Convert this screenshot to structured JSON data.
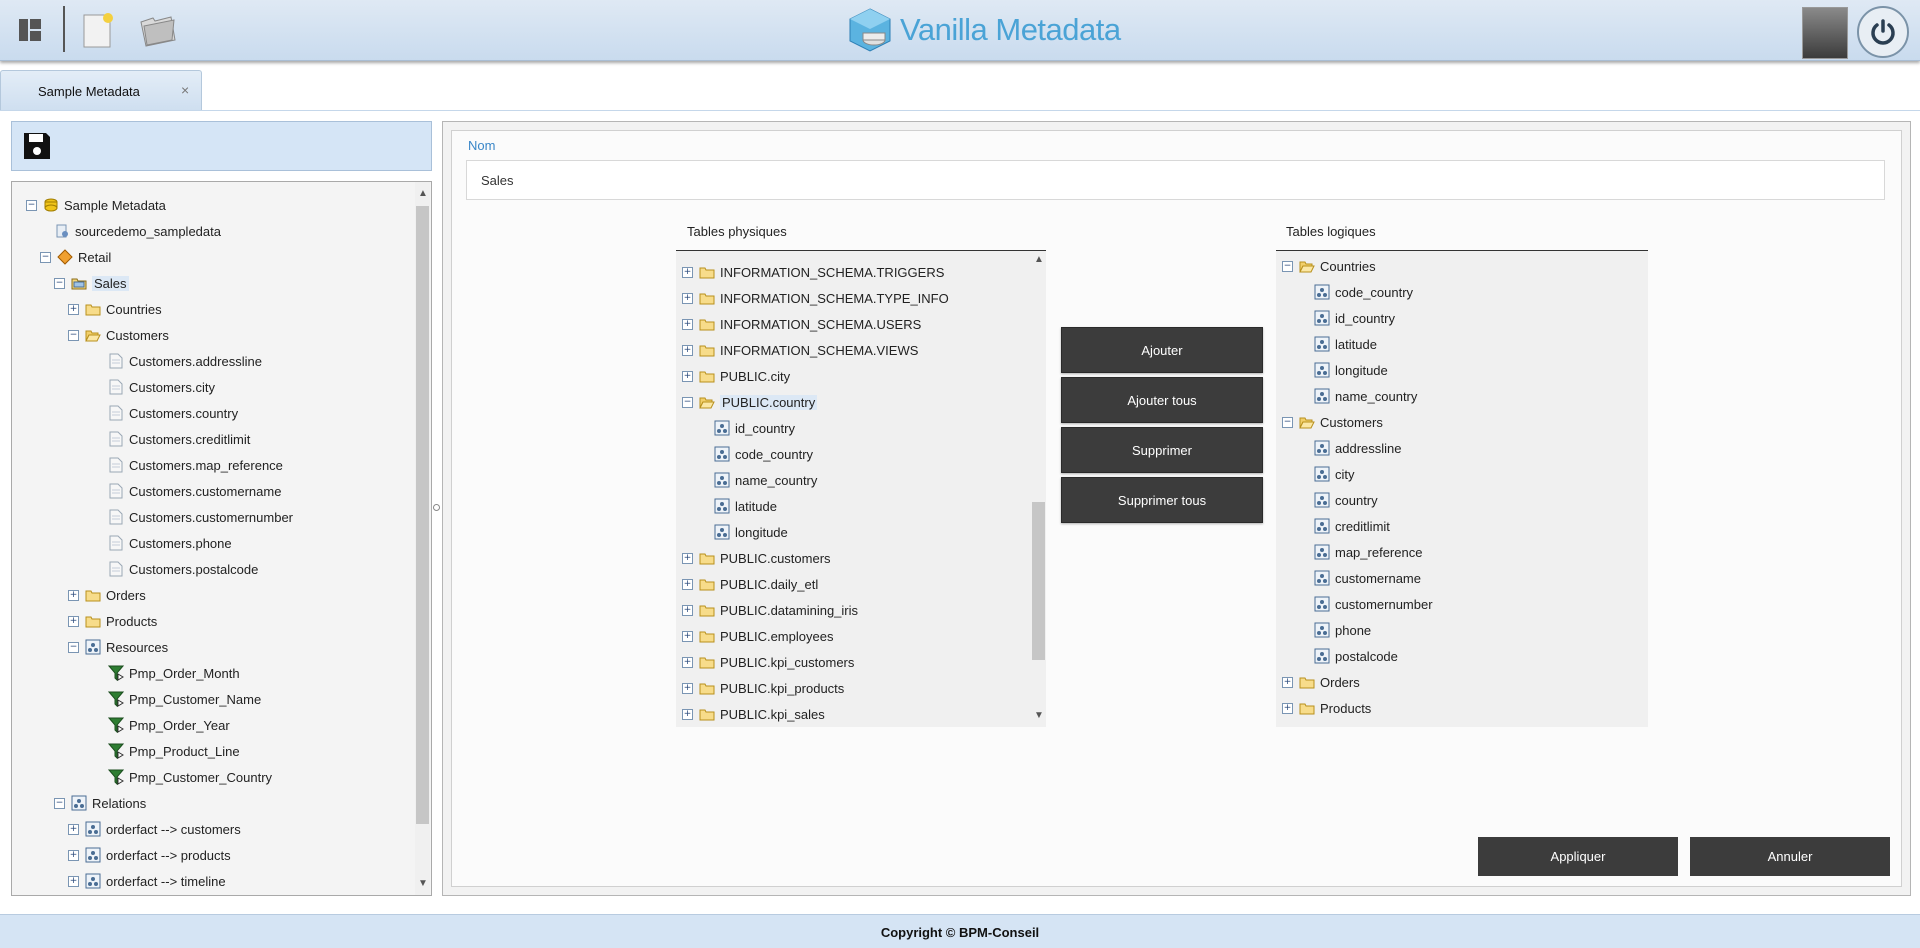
{
  "app": {
    "title": "Vanilla Metadata"
  },
  "tab": {
    "label": "Sample Metadata",
    "close": "×"
  },
  "tree": {
    "items": [
      {
        "label": "Sample Metadata",
        "expander": "⊟",
        "icon": "metadata-icon"
      },
      {
        "label": "sourcedemo_sampledata",
        "icon": "datasource-icon"
      },
      {
        "label": "Retail",
        "expander": "⊟",
        "icon": "business-model-icon"
      },
      {
        "label": "Sales",
        "expander": "⊟",
        "icon": "package-icon"
      },
      {
        "label": "Countries",
        "expander": "⊞",
        "icon": "folder-icon"
      },
      {
        "label": "Customers",
        "expander": "⊟",
        "icon": "folder-open-icon"
      },
      {
        "label": "Customers.addressline",
        "icon": "column-icon"
      },
      {
        "label": "Customers.city",
        "icon": "column-icon"
      },
      {
        "label": "Customers.country",
        "icon": "column-icon"
      },
      {
        "label": "Customers.creditlimit",
        "icon": "column-icon"
      },
      {
        "label": "Customers.map_reference",
        "icon": "column-icon"
      },
      {
        "label": "Customers.customername",
        "icon": "column-icon"
      },
      {
        "label": "Customers.customernumber",
        "icon": "column-icon"
      },
      {
        "label": "Customers.phone",
        "icon": "column-icon"
      },
      {
        "label": "Customers.postalcode",
        "icon": "column-icon"
      },
      {
        "label": "Orders",
        "expander": "⊞",
        "icon": "folder-icon"
      },
      {
        "label": "Products",
        "expander": "⊞",
        "icon": "folder-icon"
      },
      {
        "label": "Resources",
        "expander": "⊟",
        "icon": "resources-icon"
      },
      {
        "label": "Pmp_Order_Month",
        "icon": "filter-icon"
      },
      {
        "label": "Pmp_Customer_Name",
        "icon": "filter-icon"
      },
      {
        "label": "Pmp_Order_Year",
        "icon": "filter-icon"
      },
      {
        "label": "Pmp_Product_Line",
        "icon": "filter-icon"
      },
      {
        "label": "Pmp_Customer_Country",
        "icon": "filter-icon"
      },
      {
        "label": "Relations",
        "expander": "⊟",
        "icon": "relations-icon"
      },
      {
        "label": "orderfact --> customers",
        "expander": "⊞",
        "icon": "relation-icon"
      },
      {
        "label": "orderfact --> products",
        "expander": "⊞",
        "icon": "relation-icon"
      },
      {
        "label": "orderfact --> timeline",
        "expander": "⊞",
        "icon": "relation-icon"
      }
    ]
  },
  "form": {
    "nom_label": "Nom",
    "nom_value": "Sales",
    "physical_title": "Tables physiques",
    "logical_title": "Tables logiques"
  },
  "physical": {
    "items": [
      {
        "label": "INFORMATION_SCHEMA.TRIGGERS",
        "expander": "⊞",
        "icon": "folder-icon"
      },
      {
        "label": "INFORMATION_SCHEMA.TYPE_INFO",
        "expander": "⊞",
        "icon": "folder-icon"
      },
      {
        "label": "INFORMATION_SCHEMA.USERS",
        "expander": "⊞",
        "icon": "folder-icon"
      },
      {
        "label": "INFORMATION_SCHEMA.VIEWS",
        "expander": "⊞",
        "icon": "folder-icon"
      },
      {
        "label": "PUBLIC.city",
        "expander": "⊞",
        "icon": "folder-icon"
      },
      {
        "label": "PUBLIC.country",
        "expander": "⊟",
        "icon": "folder-open-icon"
      },
      {
        "label": "id_country",
        "icon": "column-icon"
      },
      {
        "label": "code_country",
        "icon": "column-icon"
      },
      {
        "label": "name_country",
        "icon": "column-icon"
      },
      {
        "label": "latitude",
        "icon": "column-icon"
      },
      {
        "label": "longitude",
        "icon": "column-icon"
      },
      {
        "label": "PUBLIC.customers",
        "expander": "⊞",
        "icon": "folder-icon"
      },
      {
        "label": "PUBLIC.daily_etl",
        "expander": "⊞",
        "icon": "folder-icon"
      },
      {
        "label": "PUBLIC.datamining_iris",
        "expander": "⊞",
        "icon": "folder-icon"
      },
      {
        "label": "PUBLIC.employees",
        "expander": "⊞",
        "icon": "folder-icon"
      },
      {
        "label": "PUBLIC.kpi_customers",
        "expander": "⊞",
        "icon": "folder-icon"
      },
      {
        "label": "PUBLIC.kpi_products",
        "expander": "⊞",
        "icon": "folder-icon"
      },
      {
        "label": "PUBLIC.kpi_sales",
        "expander": "⊞",
        "icon": "folder-icon"
      }
    ]
  },
  "logical": {
    "items": [
      {
        "label": "Countries",
        "expander": "⊟",
        "icon": "folder-open-icon"
      },
      {
        "label": "code_country",
        "icon": "column-icon"
      },
      {
        "label": "id_country",
        "icon": "column-icon"
      },
      {
        "label": "latitude",
        "icon": "column-icon"
      },
      {
        "label": "longitude",
        "icon": "column-icon"
      },
      {
        "label": "name_country",
        "icon": "column-icon"
      },
      {
        "label": "Customers",
        "expander": "⊟",
        "icon": "folder-open-icon"
      },
      {
        "label": "addressline",
        "icon": "column-icon"
      },
      {
        "label": "city",
        "icon": "column-icon"
      },
      {
        "label": "country",
        "icon": "column-icon"
      },
      {
        "label": "creditlimit",
        "icon": "column-icon"
      },
      {
        "label": "map_reference",
        "icon": "column-icon"
      },
      {
        "label": "customername",
        "icon": "column-icon"
      },
      {
        "label": "customernumber",
        "icon": "column-icon"
      },
      {
        "label": "phone",
        "icon": "column-icon"
      },
      {
        "label": "postalcode",
        "icon": "column-icon"
      },
      {
        "label": "Orders",
        "expander": "⊞",
        "icon": "folder-icon"
      },
      {
        "label": "Products",
        "expander": "⊞",
        "icon": "folder-icon"
      }
    ]
  },
  "actions": {
    "add": "Ajouter",
    "add_all": "Ajouter tous",
    "remove": "Supprimer",
    "remove_all": "Supprimer tous",
    "apply": "Appliquer",
    "cancel": "Annuler"
  },
  "footer": {
    "copyright": "Copyright © BPM-Conseil"
  },
  "colors": {
    "accent": "#4aa3d6",
    "button": "#3c3c3c",
    "header": "#cfdff0"
  }
}
